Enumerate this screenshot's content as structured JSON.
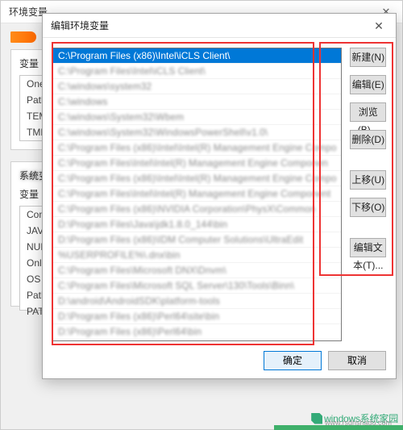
{
  "parent": {
    "title": "环境变量",
    "user_vars_header": "变量",
    "sys_vars_header": "系统变量",
    "user_vars": [
      "OneD",
      "Path",
      "TEMP",
      "TMP"
    ],
    "sys_header": "变量",
    "sys_vars": [
      "ComS",
      "JAVA",
      "NUM",
      "Onlin",
      "OS",
      "Path",
      "PATH"
    ]
  },
  "dialog": {
    "title": "编辑环境变量",
    "selected_index": 0,
    "items": [
      "C:\\Program Files (x86)\\Intel\\iCLS Client\\",
      "C:\\Program Files\\Intel\\iCLS Client\\",
      "C:\\windows\\system32",
      "C:\\windows",
      "C:\\windows\\System32\\Wbem",
      "C:\\windows\\System32\\WindowsPowerShell\\v1.0\\",
      "C:\\Program Files (x86)\\Intel\\Intel(R) Management Engine Compo",
      "C:\\Program Files\\Intel\\Intel(R) Management Engine Componen",
      "C:\\Program Files (x86)\\Intel\\Intel(R) Management Engine Compo",
      "C:\\Program Files\\Intel\\Intel(R) Management Engine Component",
      "C:\\Program Files (x86)\\NVIDIA Corporation\\PhysX\\Common",
      "D:\\Program Files\\Java\\jdk1.8.0_144\\bin",
      "D:\\Program Files (x86)\\IDM Computer Solutions\\UltraEdit",
      "%USERPROFILE%\\.dnx\\bin",
      "C:\\Program Files\\Microsoft DNX\\Dnvm\\",
      "C:\\Program Files\\Microsoft SQL Server\\130\\Tools\\Binn\\",
      "D:\\android\\AndroidSDK\\platform-tools",
      "D:\\Program Files (x86)\\Perl64\\site\\bin",
      "D:\\Program Files (x86)\\Perl64\\bin"
    ],
    "buttons": {
      "new": "新建(N)",
      "edit": "编辑(E)",
      "browse": "浏览(B)...",
      "delete": "删除(D)",
      "moveup": "上移(U)",
      "movedown": "下移(O)",
      "edittext": "编辑文本(T)..."
    },
    "ok": "确定",
    "cancel": "取消"
  },
  "watermark": {
    "brand": "windows系统家园",
    "url": "www.rsdnshadu.com"
  }
}
